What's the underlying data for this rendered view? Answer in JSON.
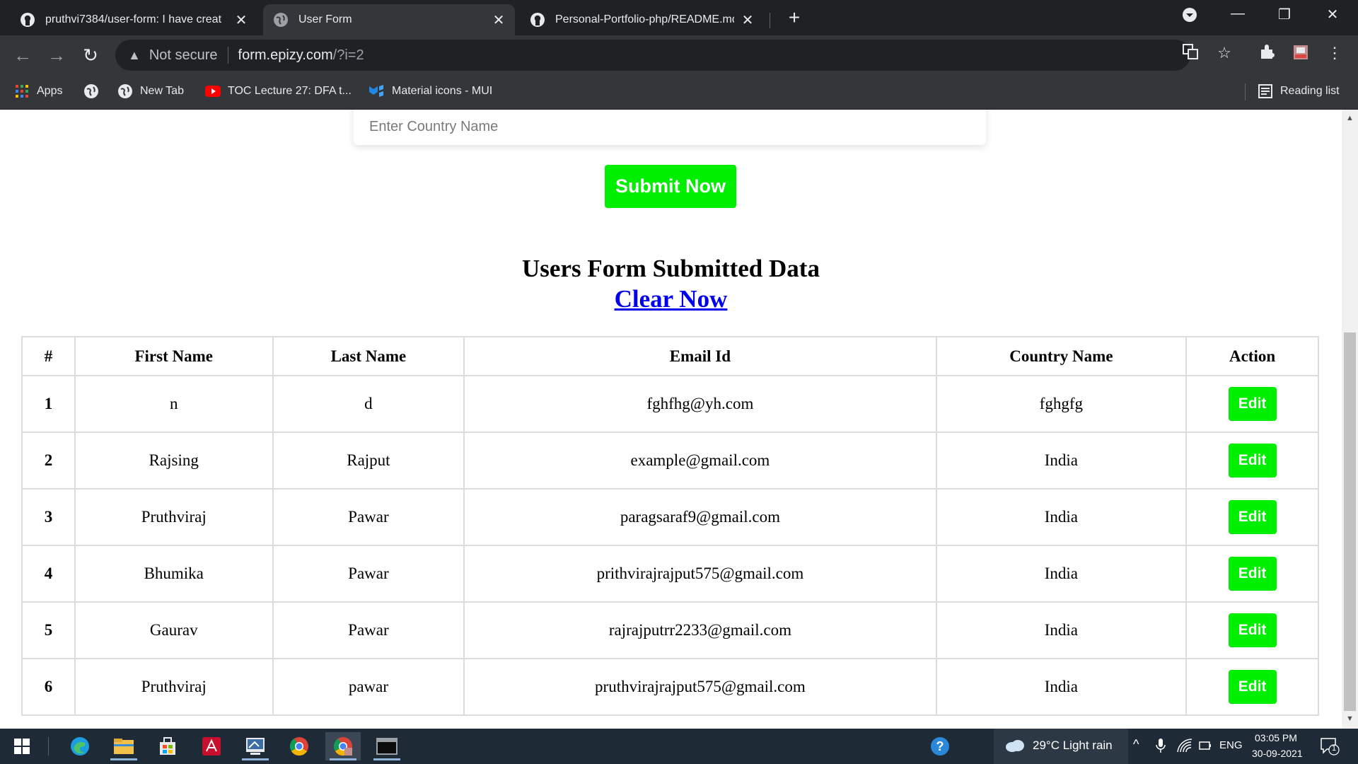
{
  "browser": {
    "tabs": [
      {
        "title": "pruthvi7384/user-form: I have creat",
        "icon": "github-icon",
        "active": false
      },
      {
        "title": "User Form",
        "icon": "globe-icon",
        "active": true
      },
      {
        "title": "Personal-Portfolio-php/README.md",
        "icon": "github-icon",
        "active": false
      }
    ],
    "address": {
      "security_label": "Not secure",
      "host": "form.epizy.com",
      "path": "/?i=2"
    },
    "bookmarks": [
      {
        "label": "Apps",
        "icon": "apps-grid-icon"
      },
      {
        "label": "",
        "icon": "globe-icon"
      },
      {
        "label": "New Tab",
        "icon": "globe-icon"
      },
      {
        "label": "TOC Lecture 27: DFA t...",
        "icon": "youtube-icon"
      },
      {
        "label": "Material icons - MUI",
        "icon": "mui-icon"
      }
    ],
    "reading_list_label": "Reading list"
  },
  "form": {
    "country_placeholder": "Enter Country Name",
    "submit_label": "Submit Now"
  },
  "section": {
    "title": "Users Form Submitted Data",
    "clear_label": "Clear Now"
  },
  "table": {
    "headers": [
      "#",
      "First Name",
      "Last Name",
      "Email Id",
      "Country Name",
      "Action"
    ],
    "rows": [
      {
        "id": "1",
        "first": "n",
        "last": "d",
        "email": "fghfhg@yh.com",
        "country": "fghgfg",
        "action": "Edit"
      },
      {
        "id": "2",
        "first": "Rajsing",
        "last": "Rajput",
        "email": "example@gmail.com",
        "country": "India",
        "action": "Edit"
      },
      {
        "id": "3",
        "first": "Pruthviraj",
        "last": "Pawar",
        "email": "paragsaraf9@gmail.com",
        "country": "India",
        "action": "Edit"
      },
      {
        "id": "4",
        "first": "Bhumika",
        "last": "Pawar",
        "email": "prithvirajrajput575@gmail.com",
        "country": "India",
        "action": "Edit"
      },
      {
        "id": "5",
        "first": "Gaurav",
        "last": "Pawar",
        "email": "rajrajputrr2233@gmail.com",
        "country": "India",
        "action": "Edit"
      },
      {
        "id": "6",
        "first": "Pruthviraj",
        "last": "pawar",
        "email": "pruthvirajrajput575@gmail.com",
        "country": "India",
        "action": "Edit"
      }
    ]
  },
  "taskbar": {
    "weather": "29°C  Light rain",
    "language": "ENG",
    "time": "03:05 PM",
    "date": "30-09-2021",
    "notification_count": "1"
  },
  "colors": {
    "accent_green": "#00ee00",
    "link_blue": "#0000ee",
    "chrome_dark": "#202124",
    "chrome_toolbar": "#35363a",
    "taskbar": "#1f2a37"
  }
}
